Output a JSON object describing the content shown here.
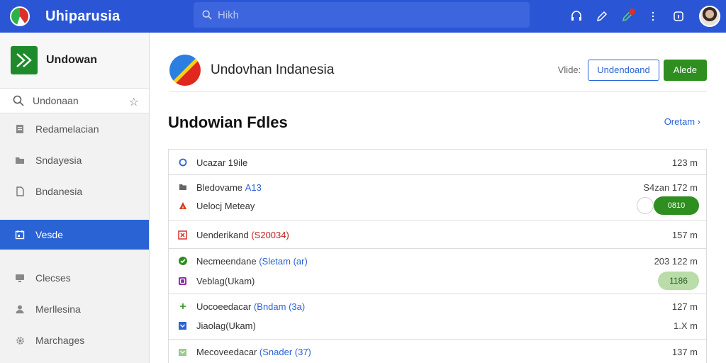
{
  "topbar": {
    "title": "Uhiparusia",
    "search_placeholder": "Hikh"
  },
  "sidebar": {
    "brand": "Undowan",
    "search_text": "Undonaan",
    "items": [
      {
        "label": "Redamelacian",
        "icon": "document-icon"
      },
      {
        "label": "Sndayesia",
        "icon": "folder-icon"
      },
      {
        "label": "Bndanesia",
        "icon": "file-icon"
      },
      {
        "label": "Vesde",
        "icon": "calendar-icon",
        "active": true
      },
      {
        "label": "Clecses",
        "icon": "monitor-icon"
      },
      {
        "label": "Merllesina",
        "icon": "user-icon"
      },
      {
        "label": "Marchages",
        "icon": "gear-icon"
      }
    ]
  },
  "header": {
    "title": "Undovhan Indanesia",
    "view_label": "Vlide:",
    "outline_button": "Undendoand",
    "green_button": "Alede"
  },
  "section": {
    "title": "Undowian Fdles",
    "link": "Oretam"
  },
  "list": {
    "rows": [
      {
        "text": "Ucazar 19ile",
        "meta": "123 m"
      },
      {
        "text": "Bledovame",
        "text_blue": "A13",
        "meta": "S4zan 172 m"
      },
      {
        "text": "Uelocj Meteay",
        "toggle_label": "0810"
      },
      {
        "text": "Uenderikand",
        "text_red": "(S20034)",
        "meta": "157 m"
      },
      {
        "text": "Necmeendane",
        "text_blue": "(Sletam (ar)",
        "meta": "203 122 m"
      },
      {
        "text": "Veblag(Ukam)",
        "pill_label": "1186"
      },
      {
        "text": "Uocoeedacar",
        "text_blue": "(Bndam (3a)",
        "meta": "127 m"
      },
      {
        "text": "Jiaolag(Ukam)",
        "meta": "1.X m"
      },
      {
        "text": "Mecoveedacar",
        "text_blue": "(Snader (37)",
        "meta": "137 m"
      }
    ]
  },
  "colors": {
    "topbar": "#2a56d6",
    "active_nav": "#2a63d4",
    "primary_green": "#2e8e1f"
  }
}
